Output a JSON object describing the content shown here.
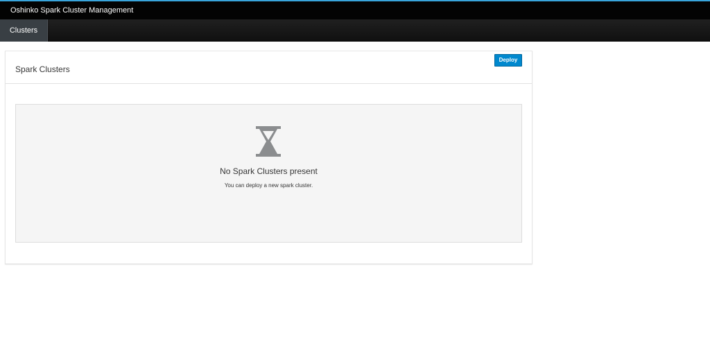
{
  "app": {
    "title": "Oshinko Spark Cluster Management"
  },
  "nav": {
    "tabs": [
      {
        "label": "Clusters",
        "active": true
      }
    ]
  },
  "panel": {
    "title": "Spark Clusters",
    "deploy_label": "Deploy",
    "annotation_icon": "arrow-right-icon"
  },
  "empty_state": {
    "icon": "hourglass-icon",
    "title": "No Spark Clusters present",
    "subtitle": "You can deploy a new spark cluster."
  },
  "colors": {
    "accent": "#39a5dc",
    "button": "#0088ce",
    "annotation_arrow": "#f0ab00",
    "empty_bg": "#f5f5f5"
  }
}
